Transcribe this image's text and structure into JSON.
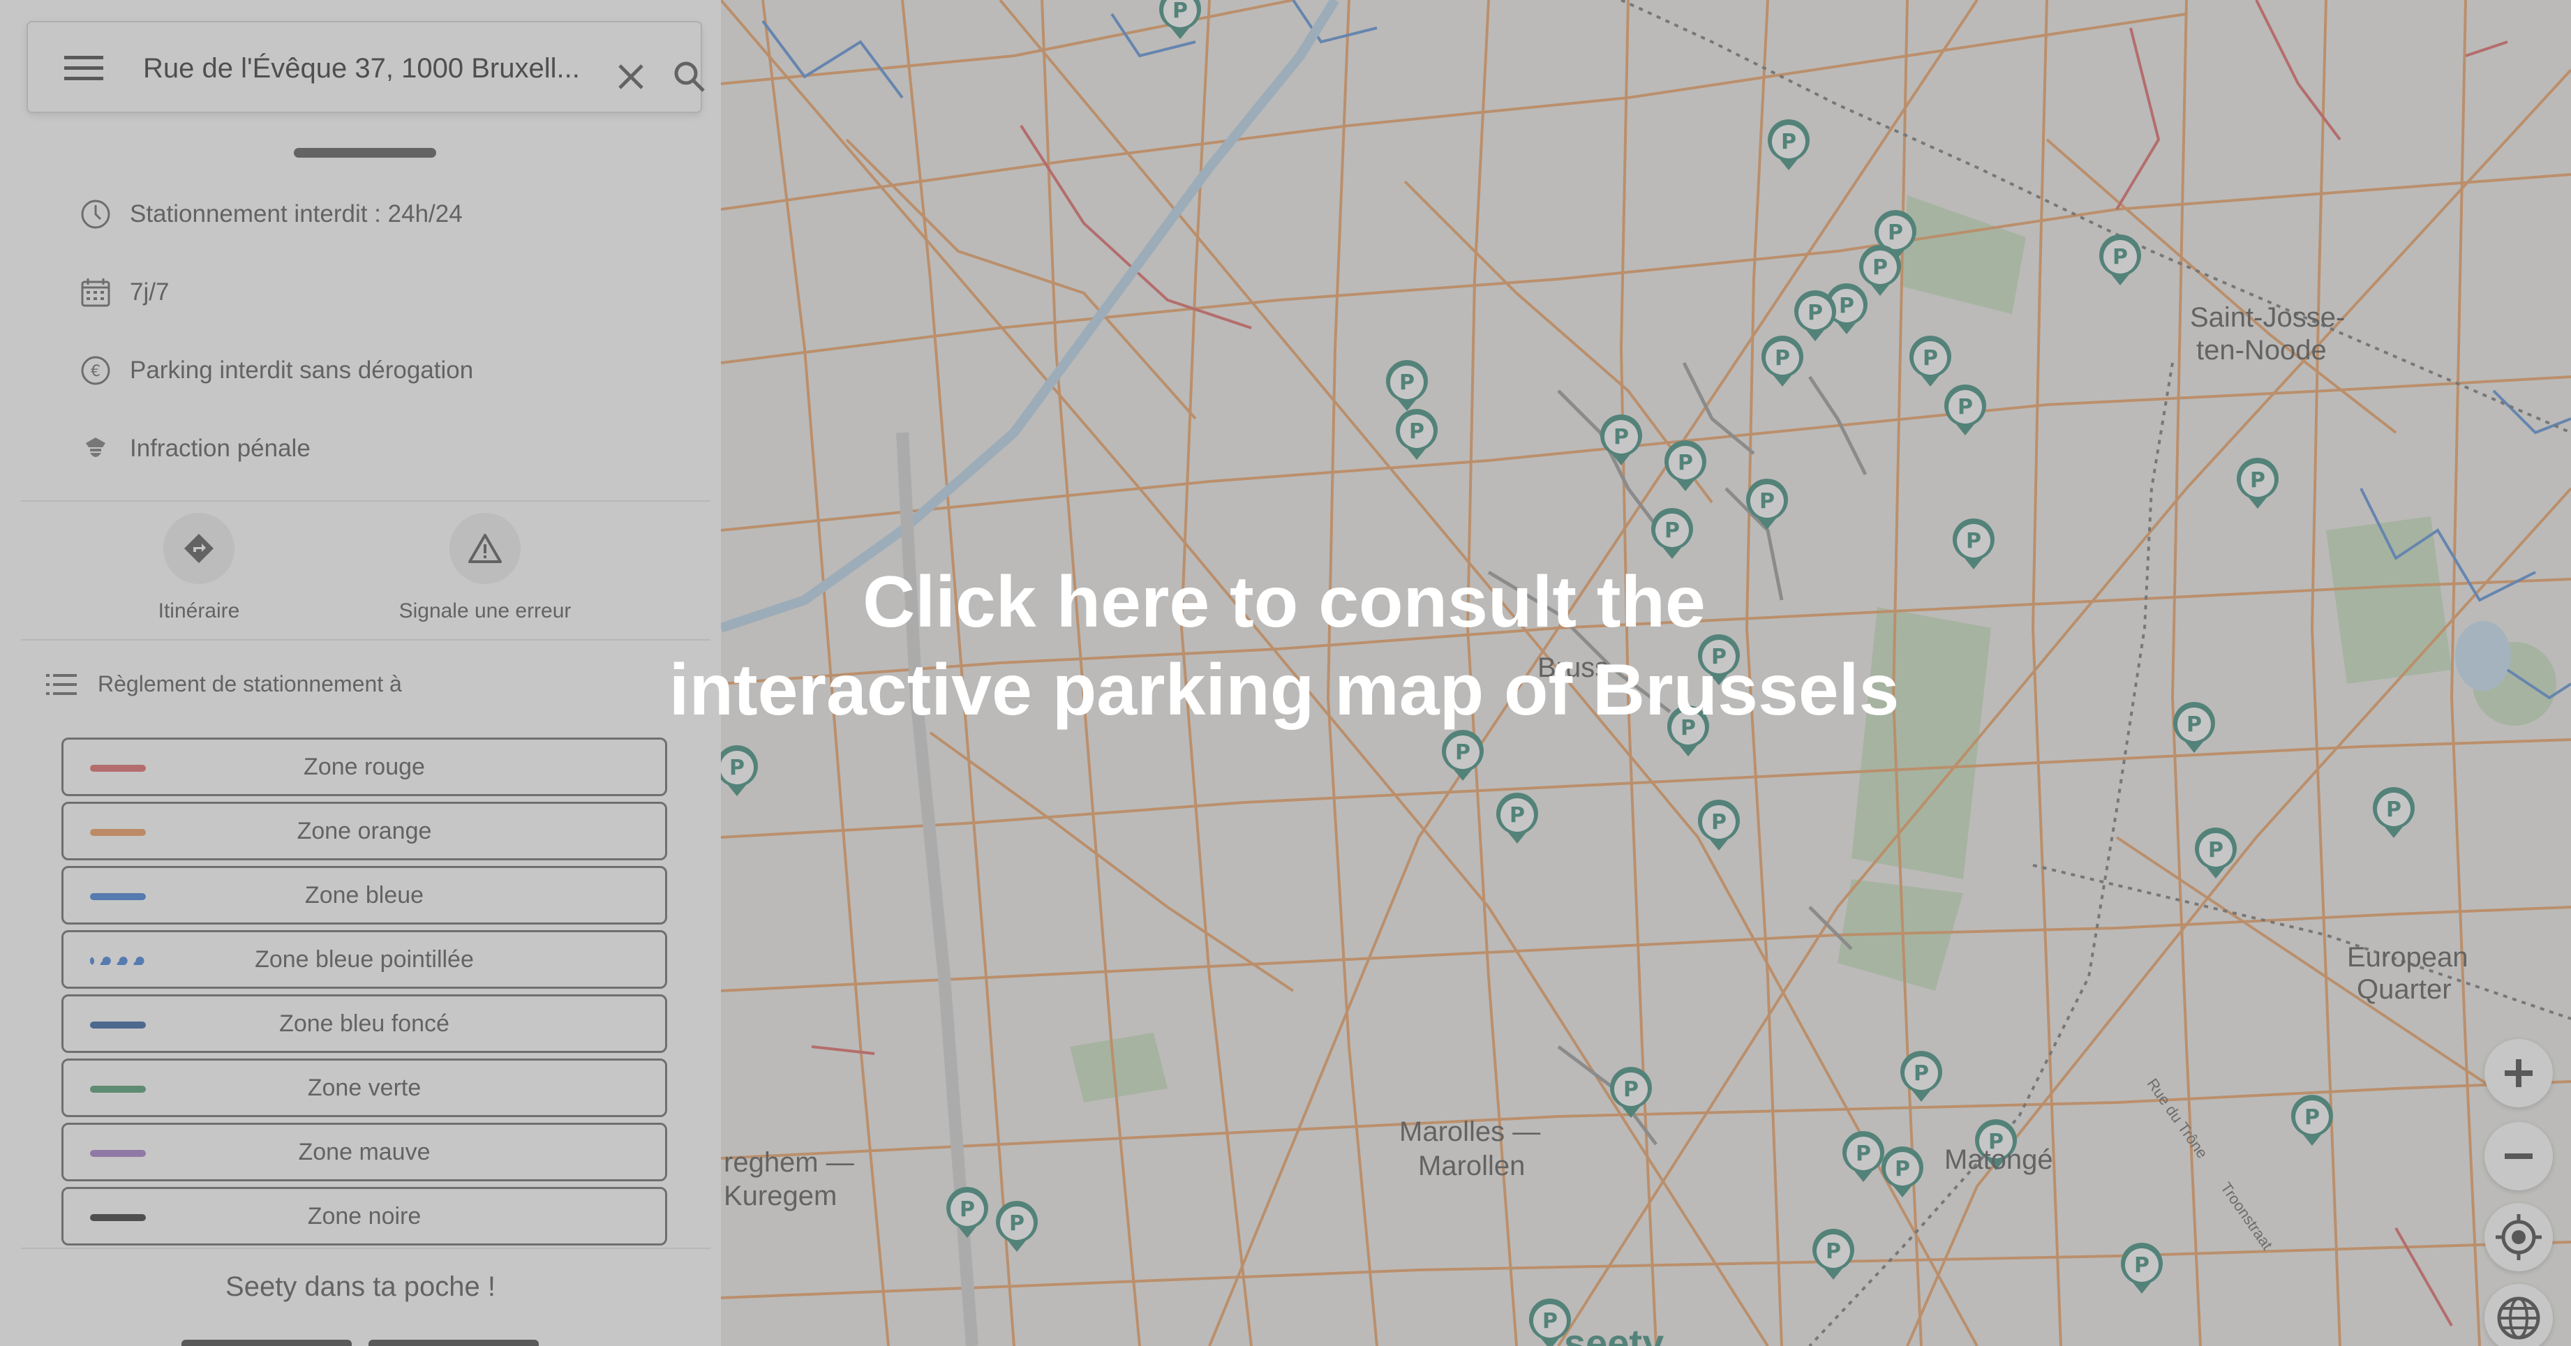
{
  "search": {
    "address": "Rue de l'Évêque 37, 1000 Bruxell..."
  },
  "info": {
    "rows": [
      {
        "icon": "clock-icon",
        "text": "Stationnement interdit : 24h/24"
      },
      {
        "icon": "calendar-icon",
        "text": "7j/7"
      },
      {
        "icon": "euro-icon",
        "text": "Parking interdit sans dérogation"
      },
      {
        "icon": "police-cap-icon",
        "text": "Infraction pénale"
      }
    ]
  },
  "actions": {
    "itinerary_label": "Itinéraire",
    "report_label": "Signale une erreur"
  },
  "regulation": {
    "title": "Règlement de stationnement à"
  },
  "zones": [
    {
      "label": "Zone rouge",
      "color": "#e06666",
      "style": "solid"
    },
    {
      "label": "Zone orange",
      "color": "#ee9a58",
      "style": "solid"
    },
    {
      "label": "Zone bleue",
      "color": "#3d7fd8",
      "style": "solid"
    },
    {
      "label": "Zone bleue pointillée",
      "color": "#3d7fd8",
      "style": "dotted"
    },
    {
      "label": "Zone bleu foncé",
      "color": "#2f5f9e",
      "style": "solid"
    },
    {
      "label": "Zone verte",
      "color": "#4f9a6e",
      "style": "solid"
    },
    {
      "label": "Zone mauve",
      "color": "#a27bc7",
      "style": "solid"
    },
    {
      "label": "Zone noire",
      "color": "#333333",
      "style": "solid"
    }
  ],
  "promo": {
    "text": "Seety dans ta poche !"
  },
  "overlay": {
    "line1": "Click here to consult the",
    "line2": "interactive parking map of Brussels"
  },
  "map": {
    "labels": [
      {
        "id": "saint-josse",
        "text": "Saint-Josse-"
      },
      {
        "id": "ten-noode",
        "text": "ten-Noode"
      },
      {
        "id": "european",
        "text": "European"
      },
      {
        "id": "quarter",
        "text": "Quarter"
      },
      {
        "id": "marolles",
        "text": "Marolles —"
      },
      {
        "id": "marollen",
        "text": "Marollen"
      },
      {
        "id": "matonge",
        "text": "Matongé"
      },
      {
        "id": "anderlecht1",
        "text": "reghem —"
      },
      {
        "id": "anderlecht2",
        "text": "Kuregem"
      },
      {
        "id": "rue-trone",
        "text": "Rue du Trône"
      },
      {
        "id": "trone-straat",
        "text": "Troonstraat"
      },
      {
        "id": "seety-logo",
        "text": "seety"
      },
      {
        "id": "bruss",
        "text": "Bruss"
      }
    ],
    "parking_marker_glyph": "P",
    "controls": [
      "zoom-in",
      "zoom-out",
      "locate",
      "globe"
    ]
  }
}
